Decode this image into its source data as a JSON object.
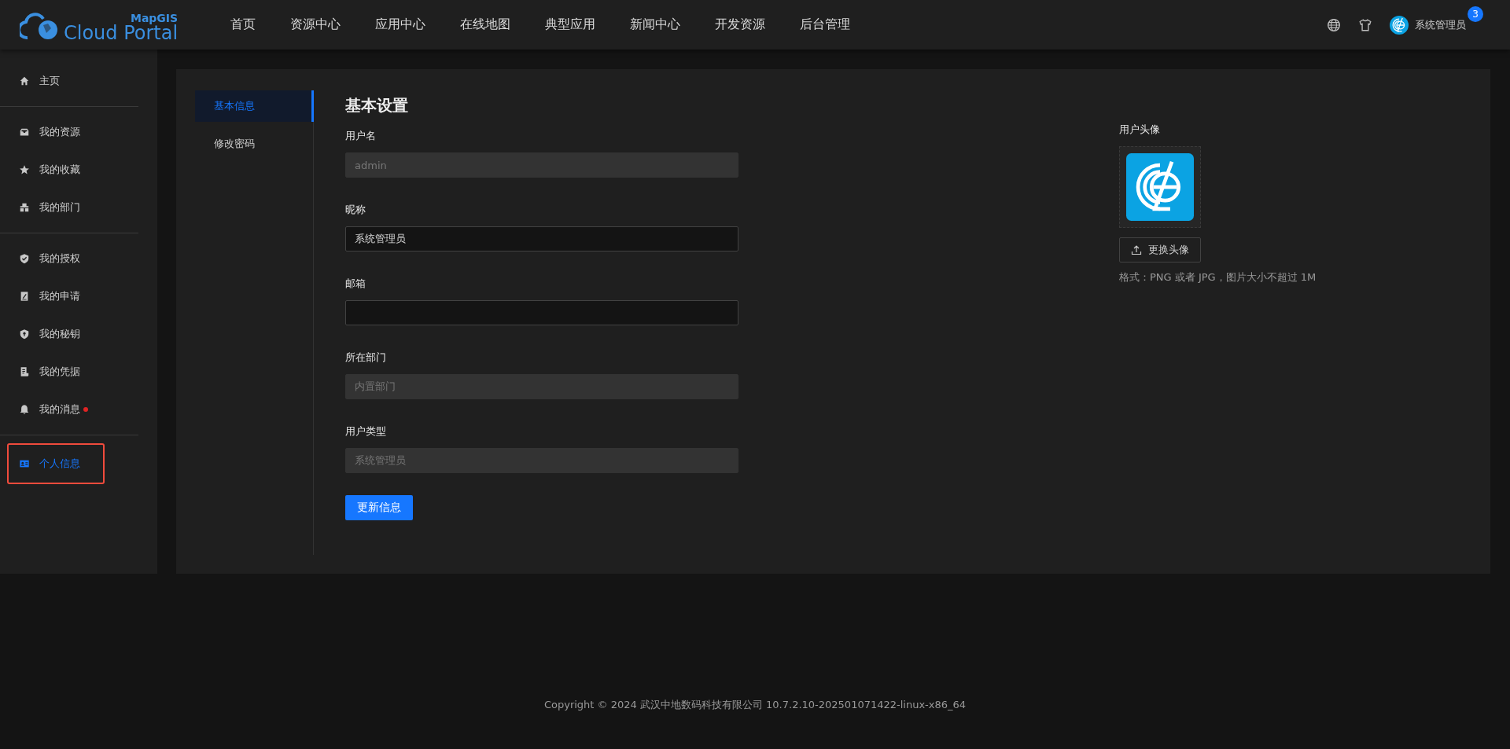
{
  "header": {
    "logo": {
      "top": "MapGIS",
      "brand": "Cloud Portal"
    },
    "nav": [
      {
        "label": "首页"
      },
      {
        "label": "资源中心"
      },
      {
        "label": "应用中心"
      },
      {
        "label": "在线地图"
      },
      {
        "label": "典型应用"
      },
      {
        "label": "新闻中心"
      },
      {
        "label": "开发资源"
      },
      {
        "label": "后台管理"
      }
    ],
    "user": {
      "name": "系统管理员",
      "badge": "3"
    }
  },
  "sidebar": {
    "groups": [
      [
        {
          "label": "主页",
          "selected": false,
          "dot": false,
          "annotated": false
        }
      ],
      [
        {
          "label": "我的资源",
          "selected": false,
          "dot": false,
          "annotated": false
        },
        {
          "label": "我的收藏",
          "selected": false,
          "dot": false,
          "annotated": false
        },
        {
          "label": "我的部门",
          "selected": false,
          "dot": false,
          "annotated": false
        }
      ],
      [
        {
          "label": "我的授权",
          "selected": false,
          "dot": false,
          "annotated": false
        },
        {
          "label": "我的申请",
          "selected": false,
          "dot": false,
          "annotated": false
        },
        {
          "label": "我的秘钥",
          "selected": false,
          "dot": false,
          "annotated": false
        },
        {
          "label": "我的凭据",
          "selected": false,
          "dot": false,
          "annotated": false
        },
        {
          "label": "我的消息",
          "selected": false,
          "dot": true,
          "annotated": false
        }
      ],
      [
        {
          "label": "个人信息",
          "selected": true,
          "dot": false,
          "annotated": true
        }
      ]
    ]
  },
  "tabs": [
    {
      "label": "基本信息",
      "selected": true
    },
    {
      "label": "修改密码",
      "selected": false
    }
  ],
  "form": {
    "title": "基本设置",
    "fields": [
      {
        "label": "用户名",
        "value": "admin",
        "disabled": true
      },
      {
        "label": "昵称",
        "value": "系统管理员",
        "disabled": false
      },
      {
        "label": "邮箱",
        "disabled": false
      },
      {
        "label": "所在部门",
        "value": "内置部门",
        "disabled": true
      },
      {
        "label": "用户类型",
        "value": "系统管理员",
        "disabled": true
      }
    ],
    "button": "更新信息"
  },
  "avatar": {
    "label": "用户头像",
    "button": "更换头像",
    "hint": "格式：PNG 或者 JPG，图片大小不超过 1M"
  },
  "footer": "Copyright © 2024 武汉中地数码科技有限公司 10.7.2.10-202501071422-linux-x86_64"
}
